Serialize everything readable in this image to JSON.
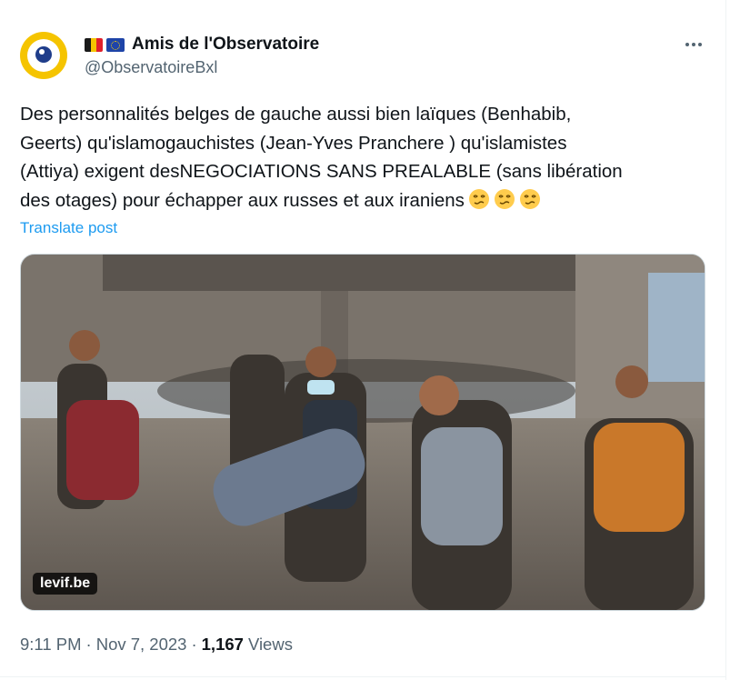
{
  "account": {
    "display_name": "Amis de l'Observatoire",
    "handle": "@ObservatoireBxl",
    "flags": [
      "belgium-flag",
      "eu-flag"
    ],
    "avatar_color": "#f5c400"
  },
  "post": {
    "text_lines": [
      "Des personnalités belges de gauche aussi bien laïques  (Benhabib,",
      "Geerts) qu'islamogauchistes (Jean-Yves Pranchere ) qu'islamistes",
      "(Attiya) exigent desNEGOCIATIONS SANS PREALABLE (sans libération",
      "des otages) pour échapper aux russes et aux iraniens"
    ],
    "emojis": [
      "woozy-face-emoji",
      "woozy-face-emoji",
      "woozy-face-emoji"
    ],
    "translate_label": "Translate post",
    "link_color": "#1d9bf0"
  },
  "media": {
    "source_label": "levif.be"
  },
  "meta": {
    "time": "9:11 PM",
    "separator": "·",
    "date": "Nov 7, 2023",
    "views_count": "1,167",
    "views_label": "Views"
  }
}
